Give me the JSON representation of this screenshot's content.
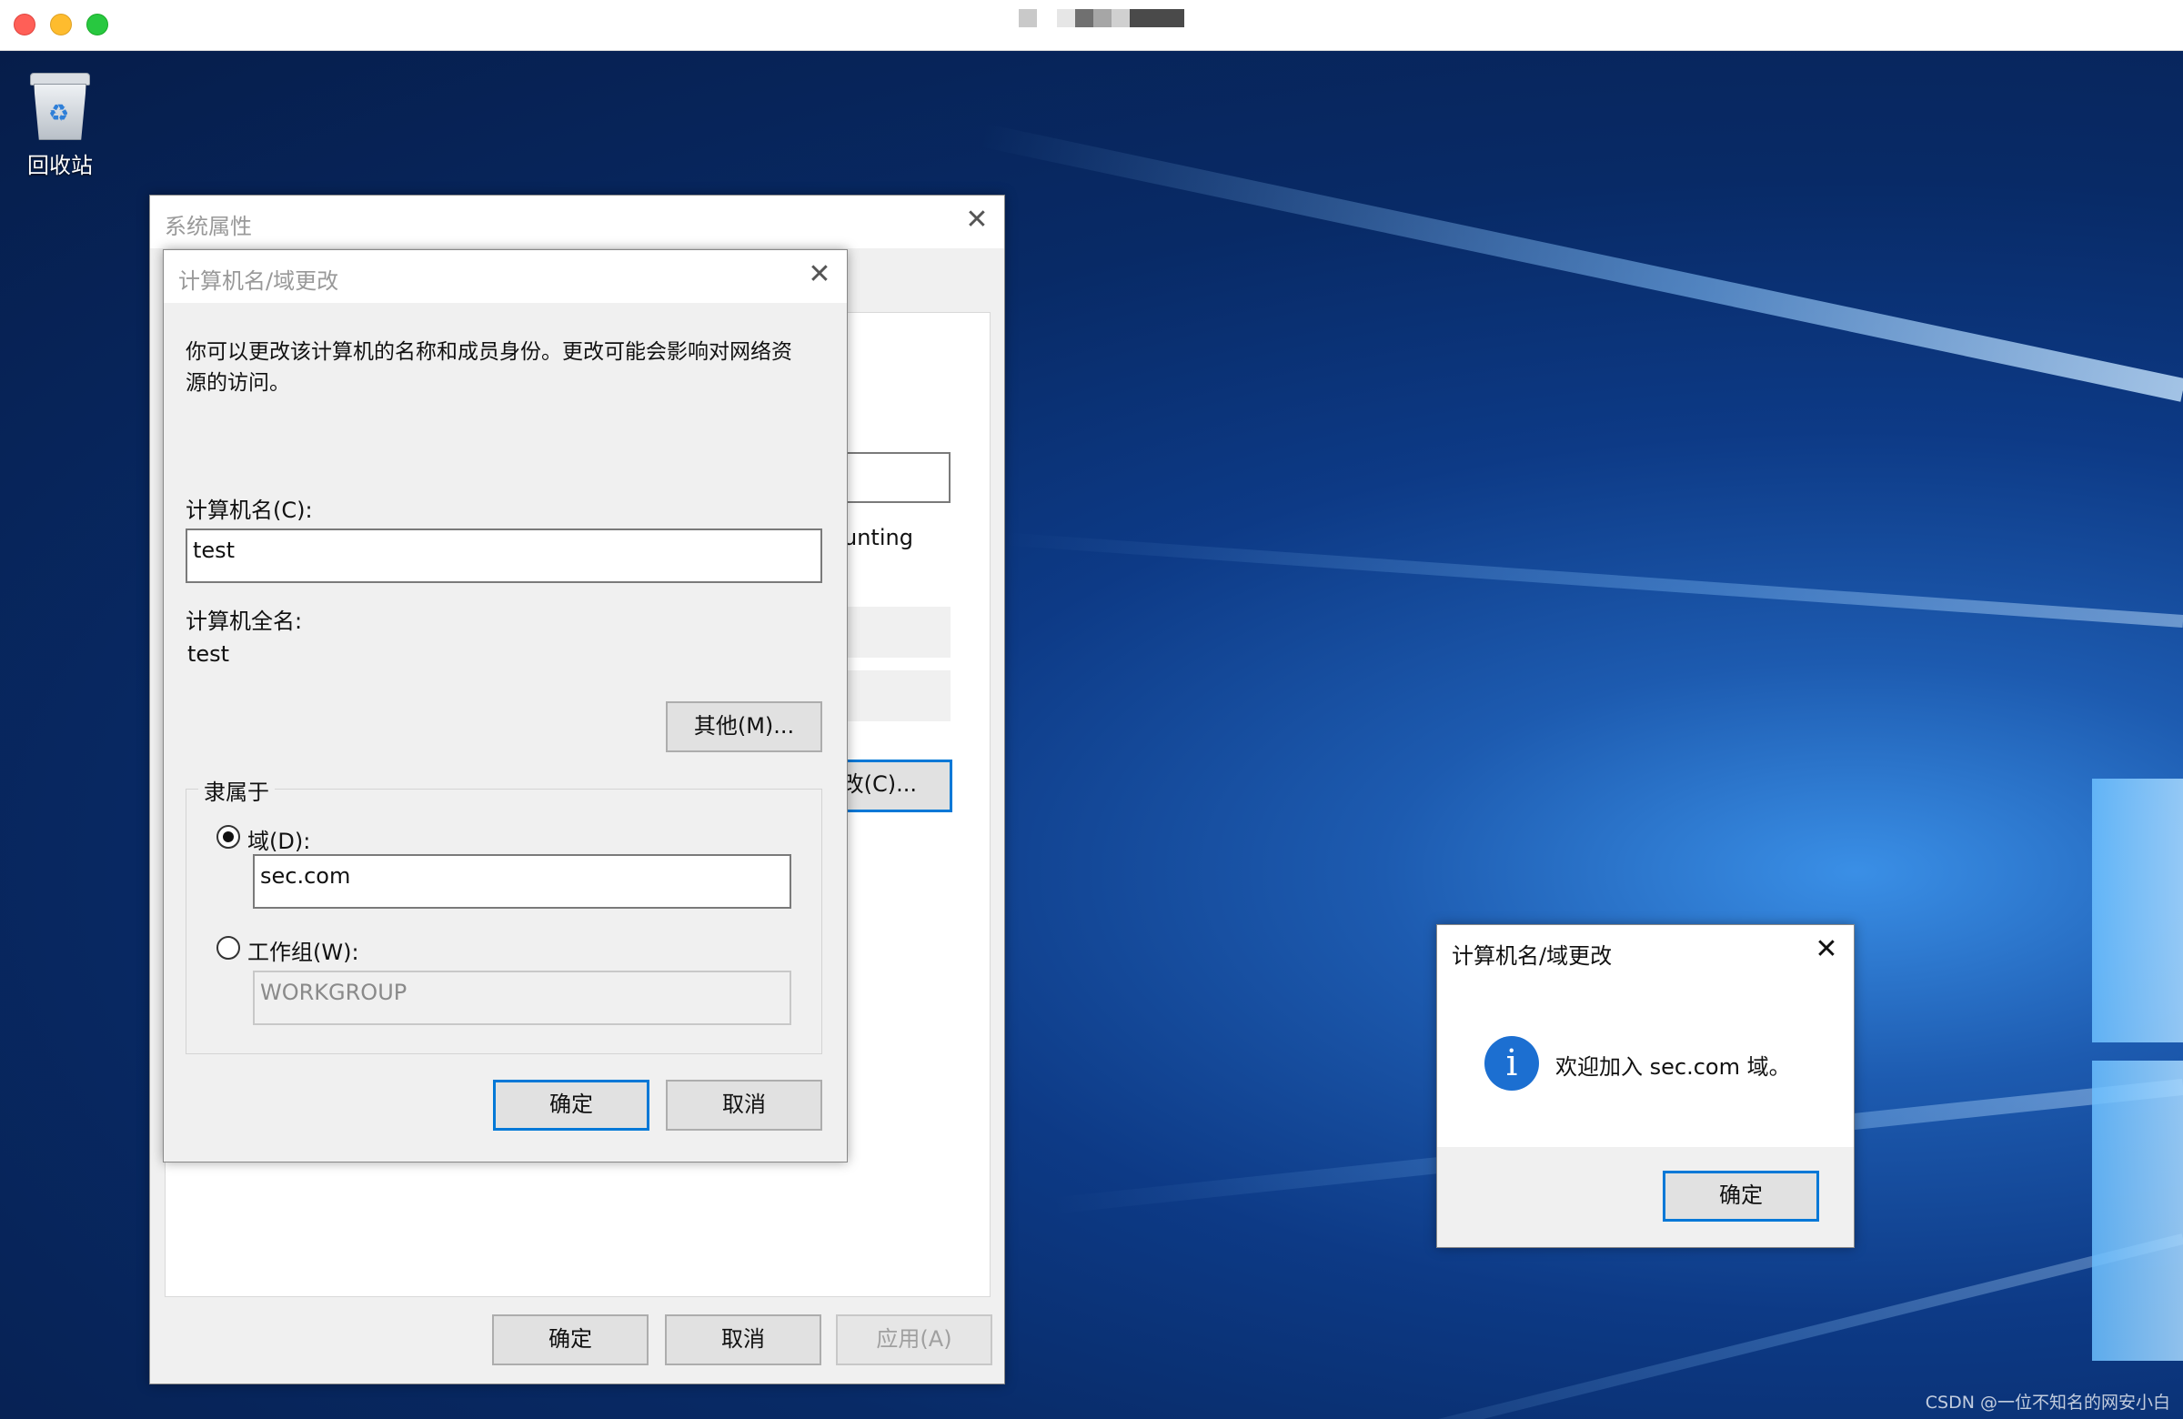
{
  "desktop": {
    "recycle_bin_label": "回收站",
    "watermark": "CSDN @一位不知名的网安小白"
  },
  "system_properties": {
    "title": "系统属性",
    "partial_text_accounting": "unting",
    "partial_change_button": "改(C)...",
    "ok_label": "确定",
    "cancel_label": "取消",
    "apply_label": "应用(A)"
  },
  "name_change_dialog": {
    "title": "计算机名/域更改",
    "description": "你可以更改该计算机的名称和成员身份。更改可能会影响对网络资源的访问。",
    "description_line1": "你可以更改该计算机的名称和成员身份。更改可能会影响对网络资",
    "description_line2": "源的访问。",
    "computer_name_label": "计算机名(C):",
    "computer_name_value": "test",
    "full_name_label": "计算机全名:",
    "full_name_value": "test",
    "more_button": "其他(M)...",
    "member_of_label": "隶属于",
    "domain_radio_label": "域(D):",
    "domain_value": "sec.com",
    "workgroup_radio_label": "工作组(W):",
    "workgroup_value": "WORKGROUP",
    "ok_label": "确定",
    "cancel_label": "取消"
  },
  "welcome_dialog": {
    "title": "计算机名/域更改",
    "message": "欢迎加入 sec.com 域。",
    "ok_label": "确定"
  }
}
